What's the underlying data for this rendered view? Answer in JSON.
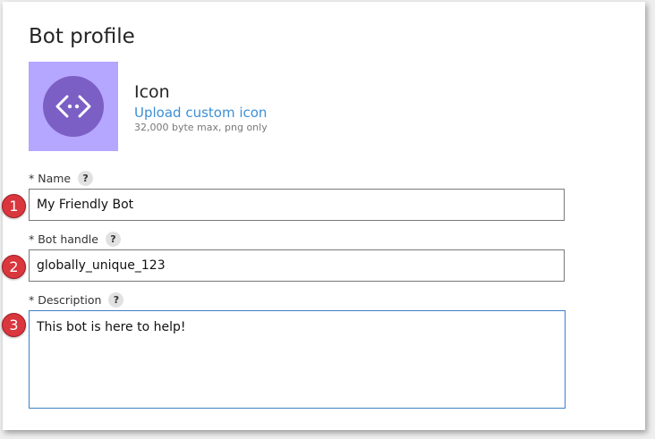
{
  "profile": {
    "title": "Bot profile"
  },
  "icon_section": {
    "icon_name": "code-brackets-icon",
    "tile_color": "#b5a6ff",
    "circle_color": "#7b5fc4",
    "heading": "Icon",
    "upload_label": "Upload custom icon",
    "note": "32,000 byte max, png only"
  },
  "fields": {
    "name": {
      "label": "* Name",
      "help": "?",
      "value": "My Friendly Bot",
      "step": "1"
    },
    "handle": {
      "label": "* Bot handle",
      "help": "?",
      "value": "globally_unique_123",
      "step": "2"
    },
    "description": {
      "label": "* Description",
      "help": "?",
      "value": "This bot is here to help!",
      "step": "3"
    }
  },
  "colors": {
    "link": "#3d8fd6",
    "badge": "#d9363e",
    "focus_border": "#3e7fc7"
  }
}
